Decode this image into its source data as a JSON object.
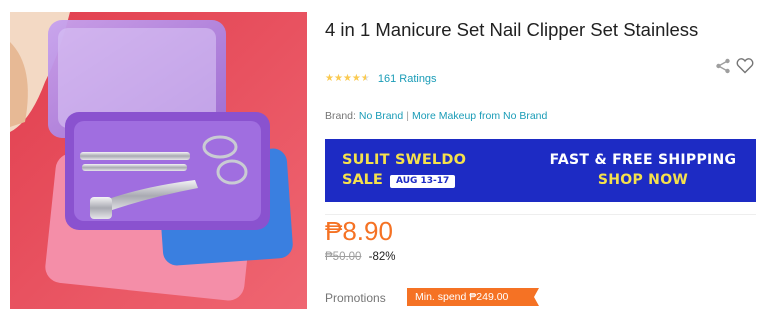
{
  "product": {
    "title": "4 in 1 Manicure Set Nail Clipper Set Stainless",
    "rating_stars": 4.5,
    "ratings_text": "161 Ratings",
    "brand_label": "Brand:",
    "brand_name": "No Brand",
    "more_link": "More Makeup from No Brand",
    "price": "₱8.90",
    "original_price": "₱50.00",
    "discount": "-82%"
  },
  "banner": {
    "line1": "SULIT SWELDO",
    "line2": "SALE",
    "dates": "AUG 13-17",
    "right1": "FAST & FREE SHIPPING",
    "right2": "SHOP NOW"
  },
  "promotions": {
    "label": "Promotions",
    "tag": "Min. spend ₱249.00"
  },
  "colors": {
    "price": "#f57224",
    "link": "#1a9cb7",
    "banner_bg": "#1d2bc4",
    "banner_accent": "#f5e14c",
    "star": "#faca51"
  },
  "icons": {
    "share": "share-icon",
    "wishlist": "heart-icon"
  }
}
